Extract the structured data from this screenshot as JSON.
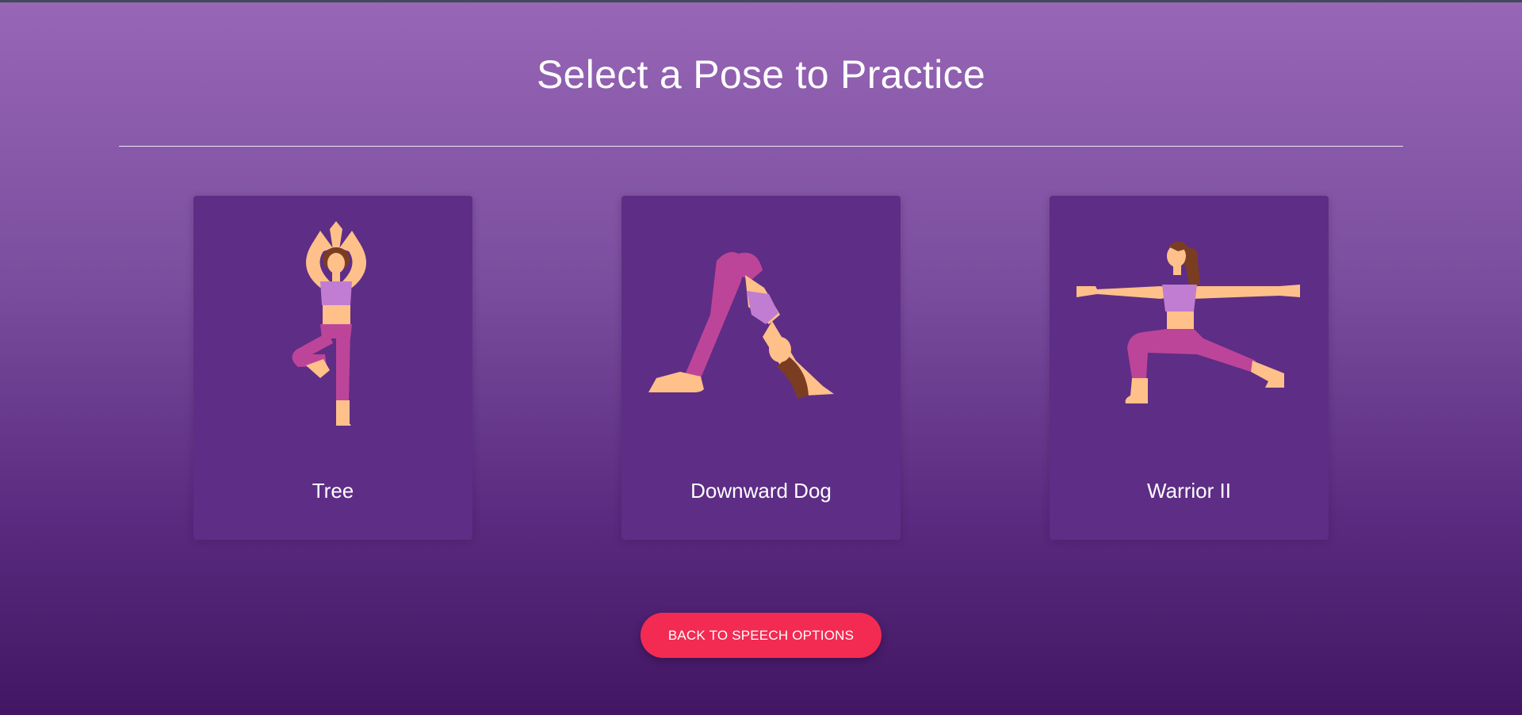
{
  "page": {
    "title": "Select a Pose to Practice"
  },
  "poses": [
    {
      "label": "Tree",
      "icon": "tree-pose-illustration"
    },
    {
      "label": "Downward Dog",
      "icon": "downward-dog-pose-illustration"
    },
    {
      "label": "Warrior II",
      "icon": "warrior-ii-pose-illustration"
    }
  ],
  "actions": {
    "back_label": "BACK TO SPEECH OPTIONS"
  },
  "colors": {
    "background_top": "#9866b6",
    "background_bottom": "#421663",
    "card": "#5e2d86",
    "button": "#f32b52",
    "skin": "#ffc08a",
    "top": "#c07dd1",
    "leggings": "#bd4599",
    "hair": "#7a3d22"
  }
}
